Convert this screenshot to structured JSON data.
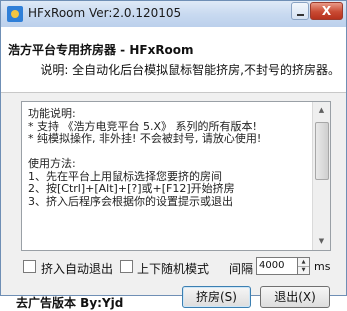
{
  "window": {
    "title": "HFxRoom Ver:2.0.120105",
    "close_glyph": "X",
    "minimize_glyph": "_"
  },
  "header": {
    "title": "浩方平台专用挤房器 - HFxRoom",
    "description": "说明: 全自动化后台模拟鼠标智能挤房,不封号的挤房器。"
  },
  "info_text": {
    "lines": [
      "功能说明:",
      "* 支持 《浩方电竞平台 5.X》 系列的所有版本!",
      "* 纯模拟操作, 非外挂! 不会被封号, 请放心使用!",
      "",
      "使用方法:",
      "1、先在平台上用鼠标选择您要挤的房间",
      "2、按[Ctrl]+[Alt]+[?]或+[F12]开始挤房",
      "3、挤入后程序会根据你的设置提示或退出"
    ]
  },
  "options": {
    "auto_exit_label": "挤入自动退出",
    "random_mode_label": "上下随机模式",
    "interval_label": "间隔",
    "interval_value": "4000",
    "interval_unit": "ms"
  },
  "footer": {
    "ad_free_label": "去广告版本 By:Yjd",
    "squeeze_button": "挤房(S)",
    "exit_button": "退出(X)"
  },
  "colors": {
    "title_bar": "#c9daf0",
    "close_button": "#c94a33",
    "body_bg": "#f0f0f0",
    "primary_border": "#3c7fb1"
  }
}
